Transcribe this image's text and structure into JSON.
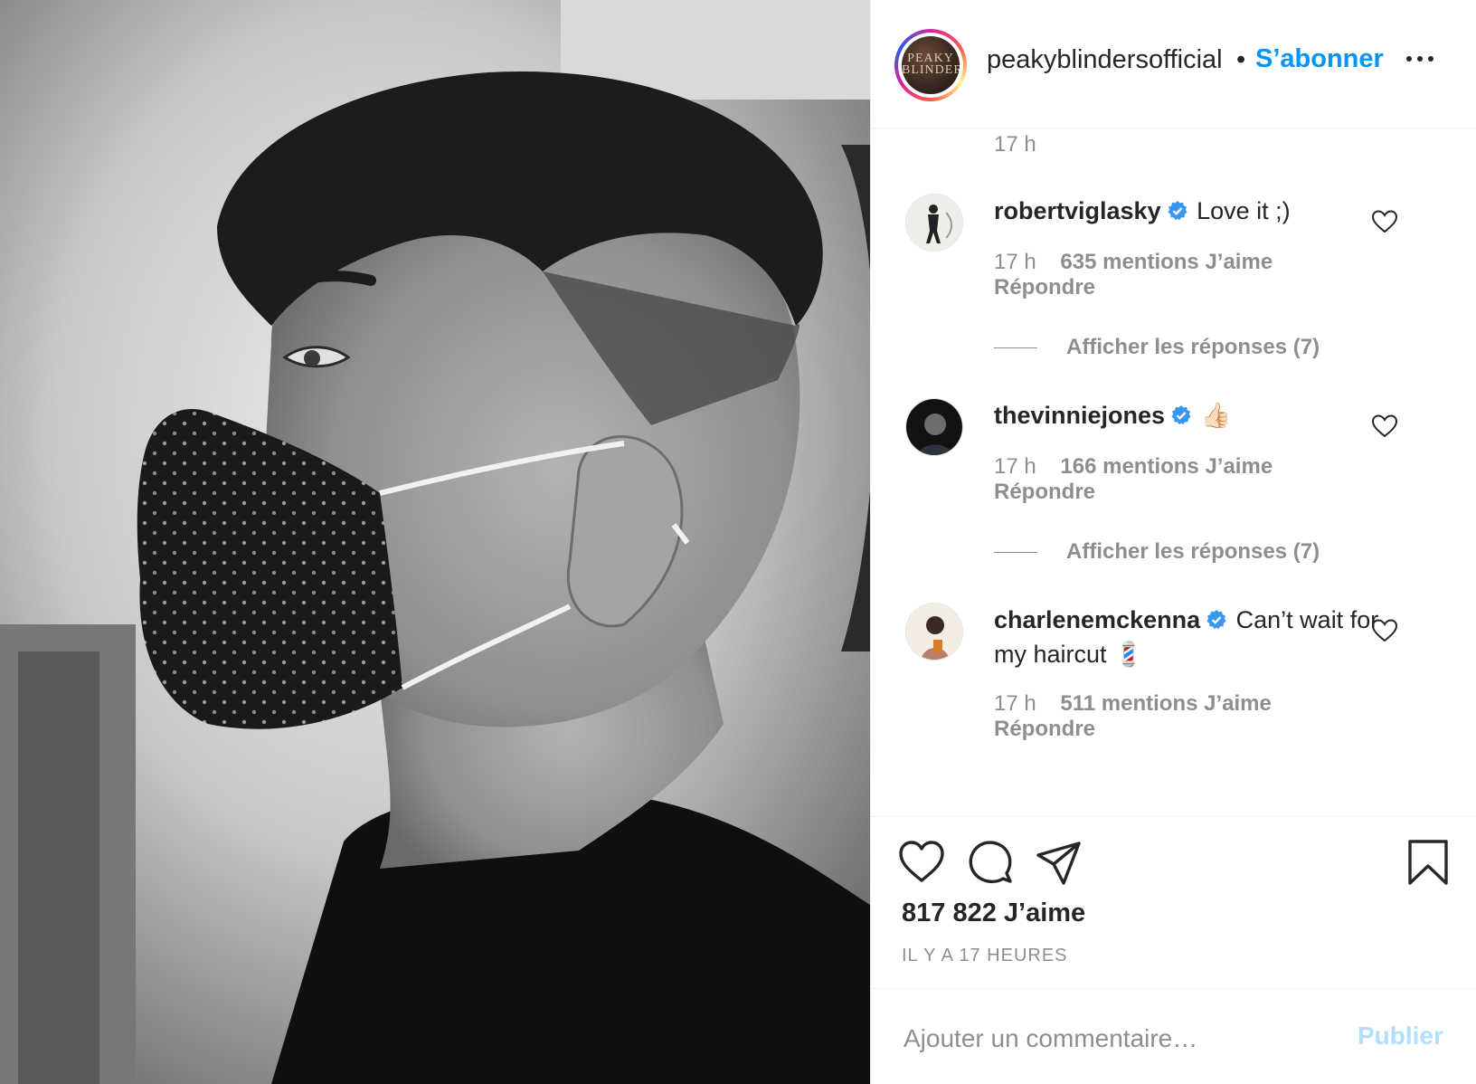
{
  "post": {
    "author": {
      "username": "peakyblindersofficial",
      "avatar_text": "PEAKY BLINDERS"
    },
    "follow_label": "S’abonner",
    "separator": "•",
    "top_time": "17 h",
    "comments": [
      {
        "username": "robertviglasky",
        "verified": true,
        "text": "Love it ;)",
        "time": "17 h",
        "likes": "635 mentions J’aime",
        "reply_label": "Répondre",
        "view_replies": "Afficher les réponses (7)"
      },
      {
        "username": "thevinniejones",
        "verified": true,
        "text": "👍🏻",
        "time": "17 h",
        "likes": "166 mentions J’aime",
        "reply_label": "Répondre",
        "view_replies": "Afficher les réponses (7)"
      },
      {
        "username": "charlenemckenna",
        "verified": true,
        "text": "Can’t wait for my haircut 💈",
        "time": "17 h",
        "likes": "511 mentions J’aime",
        "reply_label": "Répondre"
      }
    ],
    "likes_count": "817 822 J’aime",
    "timestamp": "IL Y A 17 HEURES",
    "comment_placeholder": "Ajouter un commentaire…",
    "publish_label": "Publier"
  },
  "icons": {
    "like": "heart-outline-icon",
    "comment": "speech-bubble-icon",
    "share": "paper-plane-icon",
    "save": "bookmark-icon",
    "more": "ellipsis-icon",
    "verified": "verified-badge-icon"
  },
  "colors": {
    "accent_blue": "#0095f6",
    "publish_disabled": "#b2dffc",
    "muted_text": "#8e8e8e",
    "primary_text": "#262626",
    "verified_blue": "#3897f0"
  }
}
